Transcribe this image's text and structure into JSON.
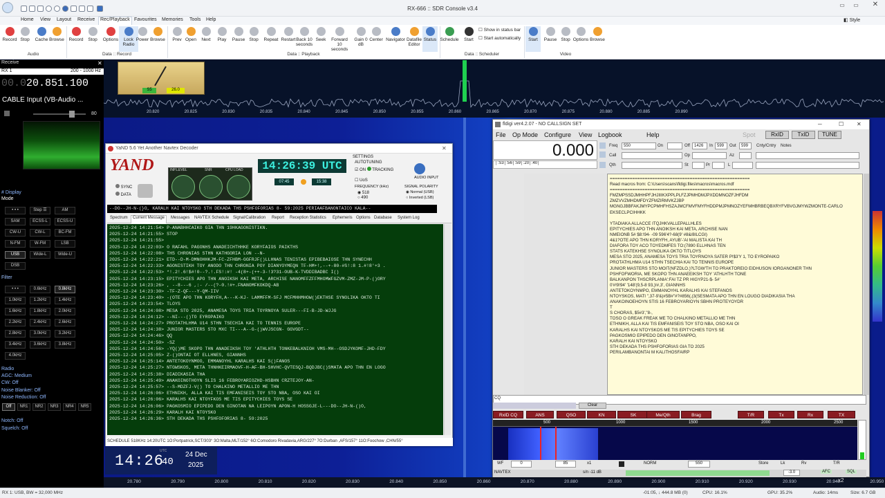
{
  "app": {
    "title": "RX-666 :: SDR Console v3.4",
    "style_label": "Style"
  },
  "menu_tabs": [
    "Home",
    "View",
    "Layout",
    "Receive",
    "Rec/Playback",
    "Favourites",
    "Memories",
    "Tools",
    "Help"
  ],
  "ribbon": {
    "buttons": [
      {
        "label": "Record",
        "icon": "record-icon"
      },
      {
        "label": "Stop",
        "icon": "stop-icon"
      },
      {
        "label": "Cache",
        "icon": "cache-icon"
      },
      {
        "label": "Browse",
        "icon": "browse-icon"
      },
      {
        "label": "Record",
        "icon": "record-icon"
      },
      {
        "label": "Stop",
        "icon": "stop-icon"
      },
      {
        "label": "Options",
        "icon": "options-icon"
      },
      {
        "label": "Lock Radio",
        "icon": "lock-icon"
      },
      {
        "label": "Power",
        "icon": "power-icon"
      },
      {
        "label": "Browse",
        "icon": "browse-icon"
      },
      {
        "label": "Prev",
        "icon": "prev-icon"
      },
      {
        "label": "Open",
        "icon": "open-icon"
      },
      {
        "label": "Next",
        "icon": "next-icon"
      },
      {
        "label": "Play",
        "icon": "play-icon"
      },
      {
        "label": "Pause",
        "icon": "pause-icon"
      },
      {
        "label": "Stop",
        "icon": "stop-icon"
      },
      {
        "label": "Repeat",
        "icon": "repeat-icon"
      },
      {
        "label": "Restart",
        "icon": "restart-icon"
      },
      {
        "label": "Back 10 seconds",
        "icon": "back-icon"
      },
      {
        "label": "Seek",
        "icon": "seek-icon"
      },
      {
        "label": "Forward 10 seconds",
        "icon": "forward-icon"
      },
      {
        "label": "Gain 0 dB",
        "icon": "gain-icon"
      },
      {
        "label": "Center",
        "icon": "center-icon"
      },
      {
        "label": "Navigator",
        "icon": "navigator-icon"
      },
      {
        "label": "Datafile Editor",
        "icon": "datafile-icon"
      },
      {
        "label": "Status",
        "icon": "status-icon"
      },
      {
        "label": "Schedule",
        "icon": "schedule-icon"
      },
      {
        "label": "Start",
        "icon": "start-icon"
      },
      {
        "label": "Start",
        "icon": "start-icon"
      },
      {
        "label": "Pause",
        "icon": "pause-icon"
      },
      {
        "label": "Stop",
        "icon": "stop-icon"
      },
      {
        "label": "Options",
        "icon": "options-icon"
      },
      {
        "label": "Browse",
        "icon": "browse-icon"
      }
    ],
    "checks": [
      "Show in status bar",
      "Start automatically"
    ],
    "groups": [
      "Audio",
      "Data :: Record",
      "Data :: Playback",
      "Data :: Scheduler",
      "Video"
    ]
  },
  "left": {
    "receive_label": "Receive",
    "rx": "RX 1",
    "range": "200 - 1000 Hz",
    "freq_dim": "00.0",
    "freq": "20.851.100",
    "input": "CABLE Input (VB-Audio ...",
    "vol": "80",
    "display_label": "# Display",
    "mode_label": "Mode",
    "modes": [
      "• • •",
      "Step ☰",
      "AM",
      "SAM",
      "ECSS-L",
      "ECSS-U",
      "CW-U",
      "CW-L",
      "BC-FM",
      "N-FM",
      "W-FM",
      "LSB",
      "USB",
      "Wide-L",
      "Wide-U",
      "DSB"
    ],
    "filter_label": "Filter",
    "filters": [
      "• • •",
      "0.6kHz",
      "0.8kHz",
      "1.0kHz",
      "1.2kHz",
      "1.4kHz",
      "1.6kHz",
      "1.8kHz",
      "2.0kHz",
      "2.2kHz",
      "2.4kHz",
      "2.6kHz",
      "2.8kHz",
      "3.0kHz",
      "3.2kHz",
      "3.4kHz",
      "3.6kHz",
      "3.8kHz",
      "4.0kHz"
    ],
    "radio_label": "Radio",
    "agc": "AGC: Medium",
    "cw": "CW: Off",
    "nb": "Noise Blanker: Off",
    "nr": "Noise Reduction: Off",
    "nr_btns": [
      "Off",
      "NR1",
      "NR2",
      "NR3",
      "NR4",
      "NR5"
    ],
    "notch": "Notch: Off",
    "squelch": "Squelch: Off"
  },
  "spectrum": {
    "top_ticks": [
      "20.820",
      "20.825",
      "20.830",
      "20.835",
      "20.840",
      "20.845",
      "20.850",
      "20.855",
      "20.860",
      "20.865",
      "20.870",
      "20.875",
      "20.880",
      "20.885",
      "20.890"
    ],
    "bottom_ticks": [
      "20.780",
      "20.790",
      "20.800",
      "20.810",
      "20.820",
      "20.830",
      "20.840",
      "20.850",
      "20.860",
      "20.870",
      "20.880",
      "20.890",
      "20.900",
      "20.910",
      "20.920",
      "20.930",
      "20.940",
      "20.950"
    ],
    "smeter_s": "S5",
    "smeter_db": "26.0"
  },
  "yand": {
    "title": "YaND 5.6 Yet Another Navtex Decoder",
    "logo": "YAND",
    "sync": "SYNC",
    "data": "DATA",
    "inp_level": "INP.LEVEL",
    "snr": "SNR",
    "cpu": "CPU LOAD",
    "clock": "14:26:39 UTC",
    "t1": "07:45",
    "t2": "15:38",
    "settings": "SETTINGS",
    "autotuning": "AUTOTUNING",
    "on": "ON",
    "tracking": "TRACKING",
    "audio_input": "AUDIO INPUT",
    "uos": "UoS",
    "freq_label": "FREQUENCY (kHz)",
    "f518": "518",
    "f490": "490",
    "polarity": "SIGNAL POLARITY",
    "normal": "Normal (USB)",
    "inverted": "Inverted (LSB)",
    "scroller": "--DO--JH-N-(}O,   KARALH KAI NTOYSKO  STH DEKADA THS PSHFOFORIAS 8- 59:2025   PERIAAFBANONTAICO KALA--",
    "tabs": [
      "Spectrum",
      "Current Message",
      "Messages",
      "NAVTEX Schedule",
      "Signal/Calibration",
      "Report",
      "Reception Statistics",
      "Ephemeris",
      "Options",
      "Database",
      "System Log"
    ],
    "log": [
      "2025-12-24 14:21:54> P-ANABHHCAIKO GIA THN 19HKAGONISTIKN.",
      "2025-12-24 14:21:55> STOP",
      "2025-12-24 14:21:55>",
      "2025-12-24 14:22:03> O RAFAHL PAGONHS ANADEICHTHHKE KORYFAIOS PAIKTHS",
      "2025-12-24 14:22:08> THS CHRONIAS STHN KATHGORIA LON --N-",
      "2025-12-24 14:22:21> ETD--D-M-DMNOHHKJM-FC-ZFHBM-GGFRJF()LLHNAS TENISTAS EPIBEBAIOSE THN SYNECHH",
      "2025-12-24 14:22:33> AGONISTIKH TOY ANODO THN CHRONIA POY DIANYOYMEQN TF-HM+!,--+-80-#S!:8 1.#!8'+3 .",
      "2025-12-24 14:22:53> *!.2!.6!$#!0--?.!.FS!:#!  -4(8+-(++-3-!3?31-OUB-K-TVDDIBADBC I()",
      "2025-12-24 14:23:15> EPITYCHIES APO THN ANOIKSH KAI META, ARCHISE NANOMFFZFFMHOMWFGZVM-ZMZ-JM-P-()ORY",
      "2025-12-24 14:23:26> , --8---6 ,:- /--(?-0.!#+.FNANOMFKOKDQ-AB",
      "2025-12-24 14:23:30> -TF-Z-QF---Y-QM-IIV",
      "2025-12-24 14:23:40> -(OTE APO THN KORYFH,A---K-KJ- LAMMFFM-SFJ MCFMHHMHOW()EKTHSE SYNOLIKA OKTO TI",
      "2025-12-24 14:23:54> TLOYS",
      "2025-12-24 14:24:08> MESA STO 2025, ANAMESA TOYS TRIA TOYRNOYA SULER---FI-B-JD-WJJG",
      "2025-12-24 14:24:12> --NI---()TO EYROPAIKO",
      "2025-12-24 14:24:27> PROTATHLHMA U14 STHN TSECHIA KAI TO TENNIS EUROPE",
      "2025-12-24 14:24:38> JUNIOR MASTERS STO MXC TI---A--G-()WVJSCGN- GGVGDT--",
      "2025-12-24 14:24:46> QQ",
      "2025-12-24 14:24:50> -SZ",
      "2025-12-24 14:24:56> -YQ()ME SKOPO THN ANADEIKSH TOY 'ATHLHTH TONKEBALKNIOH VMS-MH--OSDJYKOMF-JHD-FDY",
      "2025-12-24 14:25:05> Z-()ONTAI OT ELLHNES, GIANNHS",
      "2025-12-24 14:25:14> ANTETOKOYNMOO,  EMMANOYHL KARALHS  KAI S()FANOS",
      "2025-12-24 14:25:27> NTGWSKOS, META THNHKEIRMAOVF-H-AF-BH-SHVHC-QVTESQJ-BQDJBC()SMATA APO THN EN LOGO",
      "2025-12-24 14:25:38>  DIADIKASIA THA",
      "2025-12-24 14:25:49> ANAKOINOTHOYN SLIS 16 FEBROYARIOZHD-HSBHN CRZTEJOY-AN-",
      "2025-12-24 14:25:57> --S-MDZFJ-V() TO CHALKINO METALLIO ME THN",
      "2025-12-24 14:26:06> ETHNIKH, ALLA KAI TIS EMFANISEIS TOY STO NBA, OSO KAI OI",
      "2025-12-24 14:26:06> KARALHS KAI NTOYFKOS ME TIS EPITYCHIES TOYS SE",
      "2025-12-24 14:26:06> PAGKOSMIO EPIPEDO DEN GINOTAN NA LEIPOYN APON-H HOSSGJE-L---DO--JH-N-()O,",
      "2025-12-24 14:26:29> KARALH KAI NTOYSKO",
      "2025-12-24 14:26:36> STH DEKADA THS PSHFOFORIAS 8- 59:2025"
    ],
    "schedule": "SCHEDULE 518KHz 14:20UTC 1O:Portpatrick,SCT/303° 3O:Malta,MLT/152° 6O:Comodoro Rivadavia,ARG/227° 7O:Durban ,AFS/157° 11O:Foochow ,CHN/55°"
  },
  "bigclock": {
    "time": "14:26",
    "sec": "40",
    "utc": "UTC",
    "day": "24 Dec",
    "year": "2025"
  },
  "fldigi": {
    "title": "fldigi ver4.2.07 - NO CALLSIGN SET",
    "menu": [
      "File",
      "Op Mode",
      "Configure",
      "View",
      "Logbook",
      "Help"
    ],
    "spot": "Spot",
    "rxid": "RxID",
    "txid": "TxID",
    "tune": "TUNE",
    "freq_display": "0.000",
    "labels": {
      "freq": "Freq",
      "on": "On",
      "off": "Off",
      "in": "In",
      "out": "Out",
      "cnty": "Cnty/Cntry",
      "notes": "Notes",
      "call": "Call",
      "op": "Op",
      "az": "Az",
      "qth": "Qth",
      "st": "St",
      "pr": "Pr",
      "l": "L"
    },
    "values": {
      "freq": "550",
      "off": "1426",
      "in": "599",
      "out": "599"
    },
    "smeter_row": "│:S3│:56│:59│:20│:40│",
    "rx_lines": [
      "========================================================",
      "Read macros from: C:\\Users\\scans\\fldigi.files\\macros\\macros.mdf",
      "========================================================",
      "FMZMPSSDJMHHPFJHJIIIKXPPLPLFZJPMHDMJPXDDMNOZFJHFDM",
      "ZMZVVZMHDMFDYZFMZIRMVKZJBP",
      "MGNGJBBFAKJMYPCPMHFHSZAJMCFMVFMYFHDDPMJPMNOZYEFMHBRBEQBXRYFVBVGJMYWZMONTE-CARLO",
      "EKSECLPCIHHKK",
      "",
      "YTADIAKA ALLACCE ITQJHKVALLEPALLHLES",
      "EPITYCHIES APO THN ANOIKSH KAI META, ARCHISE NAN",
      "NMEIONB 5# $8:!94- -09 596'4?-68(9' #8&/8ILCGI)",
      "4&1?OTE APO THN KORYFH, AYUB'-'AI MALISTA KAI TH",
      "DIAFORA TOY ACO TOYEDMFES TO:(7890 ELLHNAS TEN",
      "STATS KATEKHSE SYNOLIKA OKTO TITLOYS",
      "MESA STO 2025, ANAMESA TOYS TRIA TOYRNOYA SATER P!$3'Y 1, TO EYROPAIKO",
      "PROTATHLHMA U14 STHN TSECHIA KAI TO TENNIS EUROPE",
      "JUNIOR MASTERS STO MOIT(NFZDLO.)?LTGW'TH TO PRAKTOREIO EIDHUSON IORGANONER THN",
      "PSHFOFWORIA, ME SKOPO THN ANAEEIKSH TOY 'ATHLHTH TONE",
      "BALKANPON THSCRPLANIA':FAI TZ PR HIGYP21-$- 5#'",
      "0'#!9!94' '148'(9,5-8 93,)!#,3', GIANNHS",
      "ANTETOKOYNMPO,  EMMANOYHL KARALHS  KAI STEFANOS",
      "NTOYSKOS, MATI \",37-9'&)#5B#\"#?#856(,(3(SESMATA APO THN EN LOUGO DIADIKASIA THA",
      "ANAKOINOEHOYN STIS 16 FEBROYARIOYN SBHN PROTEYOYDR",
      "T",
      "S CHORAS, $5#3',\"8-,",
      "TOSO O GREAK FREAK ME TO CHALKINO METALLIO ME THN",
      "ETHNIKH, ALLA KAI TIS EMFANISEIS TOY STO NBA, OSO KAI OI",
      "KARALHS KAI NTOYSKOS ME TIS EPITYCHIES TOYS SE",
      "PAGKOSMIO EPIPEDO DEN GINOTANPPO,",
      "KARALH KAI NTOYSKO",
      "STH DEKADA THS PSHFOFORIAS GIA TO 2025",
      "PERILAMBANONTAI M KALITHOSFAIRP"
    ],
    "cq": "CQ",
    "clear": "Clear",
    "macro_btns": [
      "RxID CQ",
      "ANS",
      "QSO",
      "KN",
      "SK",
      "Me/Qth",
      "Brag",
      "T/R",
      "Tx",
      "Rx",
      "TX"
    ],
    "wf_scale": [
      "500",
      "1000",
      "1500",
      "2000",
      "2500"
    ],
    "ctl": {
      "wf": "WF",
      "v1": "0",
      "v2": "85",
      "x1": "x1",
      "norm": "NORM",
      "fr": "550",
      "store": "Store",
      "lk": "Lk",
      "rv": "Rv",
      "tr": "T/R"
    },
    "status": {
      "mode": "NAVTEX",
      "sn": "s/n -11 dB",
      "afc_val": "-3.0",
      "afc": "AFC",
      "sql": "SQL",
      "x2": "x2"
    }
  },
  "statusbar": {
    "left": "RX 1: USB, BW = 32,000 MHz",
    "time": "-01:05, ↓ 444.8 MB (0)",
    "cpu": "CPU: 16.1%",
    "gpu": "GPU: 35.2%",
    "audio": "Audio: 14ms",
    "size": "Size: 6.7 GB"
  },
  "colors": {
    "accent": "#3a6fc0",
    "yand_log_bg": "#053d0b",
    "fldigi_rx_bg": "#fffbd8",
    "macro_btn": "#8a1c22"
  }
}
